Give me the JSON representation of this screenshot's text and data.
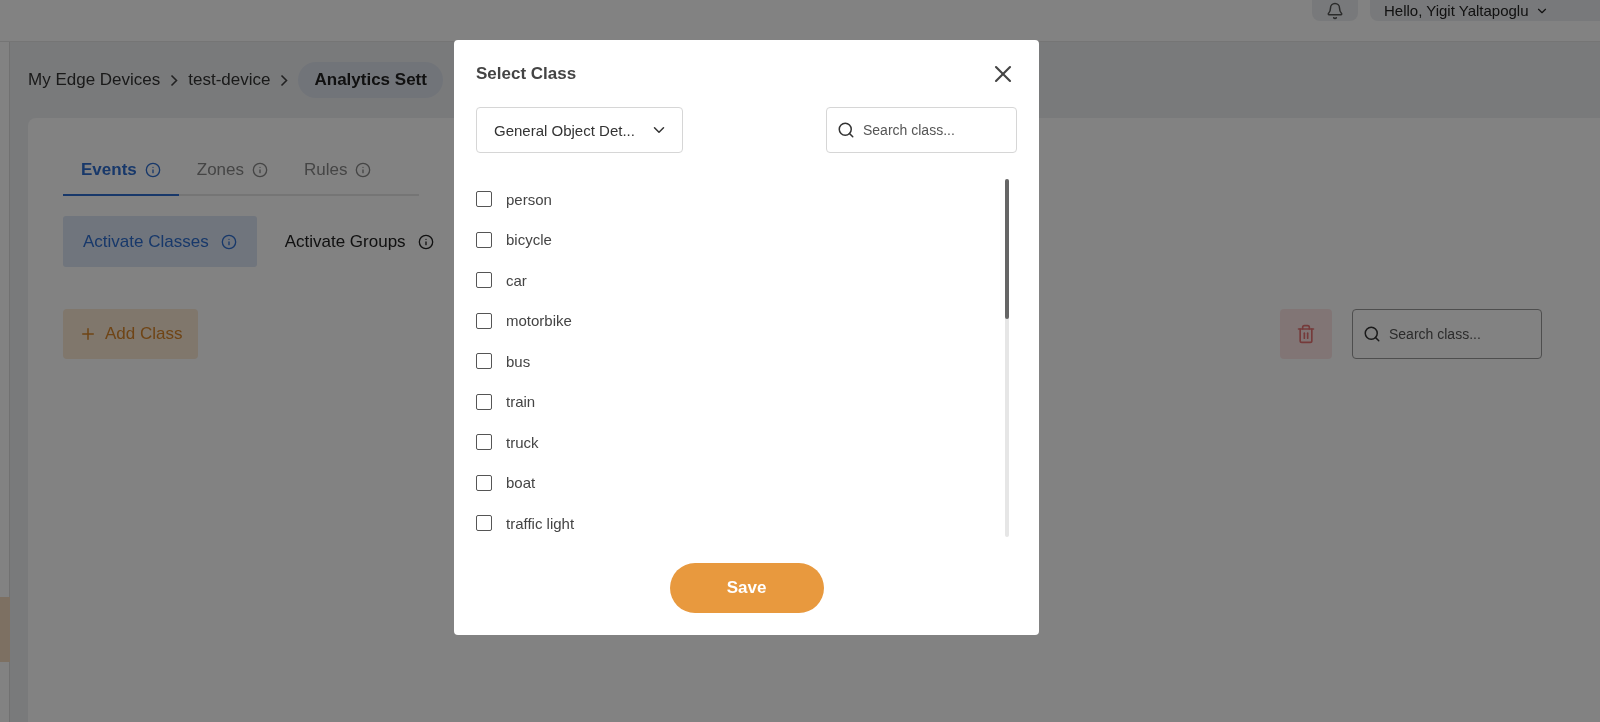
{
  "header": {
    "user_menu": "Hello, Yigit Yaltapoglu"
  },
  "breadcrumb": [
    {
      "label": "My Edge Devices",
      "selected": false
    },
    {
      "label": "test-device",
      "selected": false
    },
    {
      "label": "Analytics Sett",
      "selected": true
    }
  ],
  "tabs": [
    {
      "label": "Events",
      "selected": true
    },
    {
      "label": "Zones",
      "selected": false
    },
    {
      "label": "Rules",
      "selected": false
    }
  ],
  "sub_tabs": [
    {
      "label": "Activate Classes",
      "selected": true
    },
    {
      "label": "Activate Groups",
      "selected": false
    }
  ],
  "add_button": "Add Class",
  "search": {
    "placeholder": "Search class..."
  },
  "dialog": {
    "title": "Select Class",
    "model_select": "General Object Det...",
    "search": {
      "placeholder": "Search class..."
    },
    "classes": [
      {
        "label": "person",
        "checked": false
      },
      {
        "label": "bicycle",
        "checked": false
      },
      {
        "label": "car",
        "checked": false
      },
      {
        "label": "motorbike",
        "checked": false
      },
      {
        "label": "bus",
        "checked": false
      },
      {
        "label": "train",
        "checked": false
      },
      {
        "label": "truck",
        "checked": false
      },
      {
        "label": "boat",
        "checked": false
      },
      {
        "label": "traffic light",
        "checked": false
      }
    ],
    "save_button": "Save"
  }
}
